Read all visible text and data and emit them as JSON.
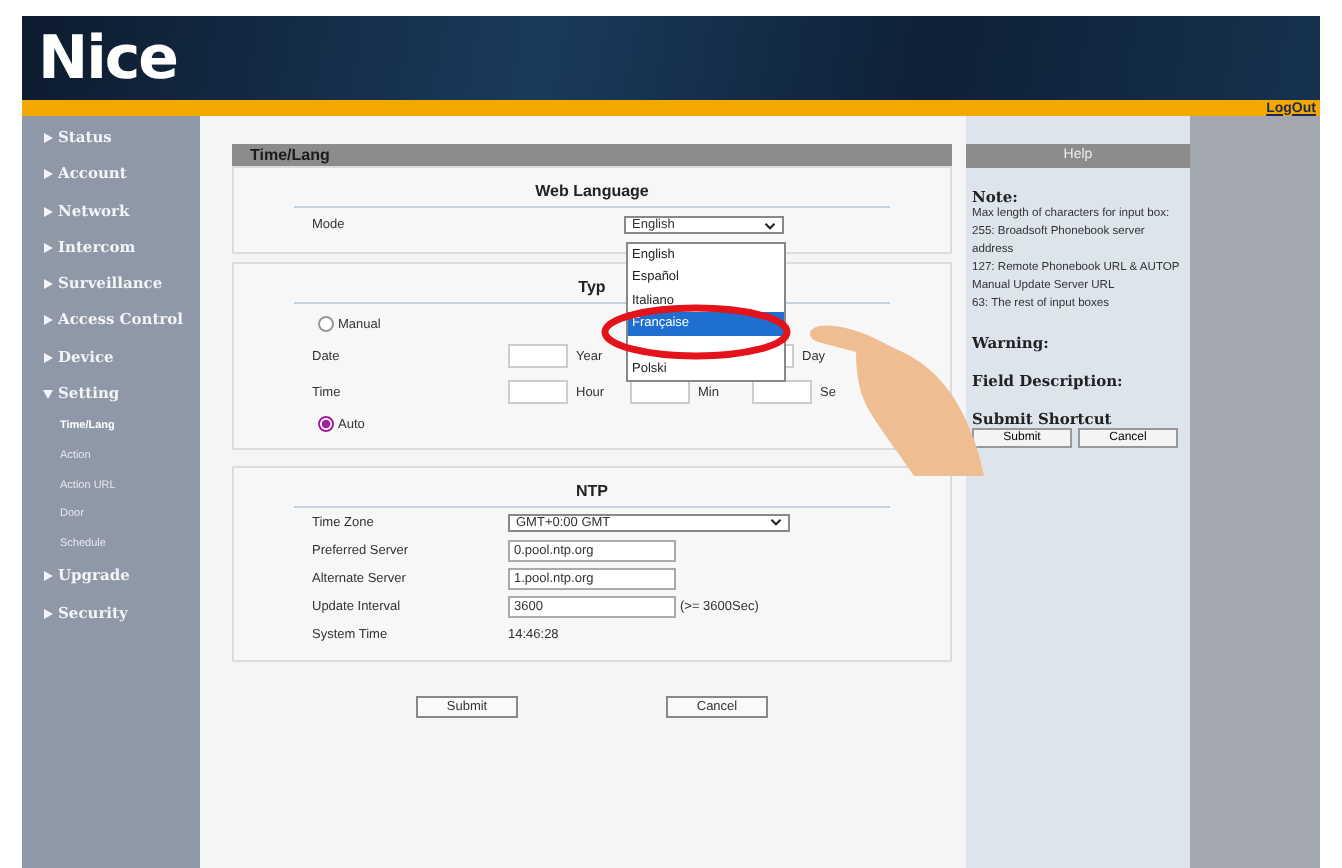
{
  "header": {
    "logo": "Nice",
    "logout": "LogOut"
  },
  "sidebar": {
    "items": [
      {
        "label": "Status",
        "expanded": false
      },
      {
        "label": "Account",
        "expanded": false
      },
      {
        "label": "Network",
        "expanded": false
      },
      {
        "label": "Intercom",
        "expanded": false
      },
      {
        "label": "Surveillance",
        "expanded": false
      },
      {
        "label": "Access Control",
        "expanded": false
      },
      {
        "label": "Device",
        "expanded": false
      },
      {
        "label": "Setting",
        "expanded": true,
        "children": [
          {
            "label": "Time/Lang",
            "selected": true
          },
          {
            "label": "Action",
            "selected": false
          },
          {
            "label": "Action URL",
            "selected": false
          },
          {
            "label": "Door",
            "selected": false
          },
          {
            "label": "Schedule",
            "selected": false
          }
        ]
      },
      {
        "label": "Upgrade",
        "expanded": false
      },
      {
        "label": "Security",
        "expanded": false
      }
    ]
  },
  "page_title": "Time/Lang",
  "web_language": {
    "title": "Web Language",
    "mode_label": "Mode",
    "mode_value": "English",
    "options": [
      {
        "label": "English",
        "selected": false
      },
      {
        "label": "Español",
        "selected": false
      },
      {
        "label": "Italiano",
        "selected": false
      },
      {
        "label": "Française",
        "selected": true
      },
      {
        "label": "Polski",
        "selected": false
      }
    ]
  },
  "type": {
    "title": "Typ",
    "manual": {
      "label": "Manual",
      "selected": false
    },
    "auto": {
      "label": "Auto",
      "selected": true
    },
    "date_label": "Date",
    "time_label": "Time",
    "date_units": [
      "Year",
      "Day"
    ],
    "time_units": [
      "Hour",
      "Min",
      "Se"
    ]
  },
  "ntp": {
    "title": "NTP",
    "rows": [
      {
        "kind": "select",
        "label": "Time Zone",
        "value": "GMT+0:00 GMT"
      },
      {
        "kind": "input",
        "label": "Preferred Server",
        "value": "0.pool.ntp.org"
      },
      {
        "kind": "input",
        "label": "Alternate Server",
        "value": "1.pool.ntp.org"
      },
      {
        "kind": "input",
        "label": "Update Interval",
        "value": "3600",
        "hint": "(>= 3600Sec)"
      },
      {
        "kind": "text",
        "label": "System Time",
        "value": "14:46:28"
      }
    ]
  },
  "buttons": [
    "Submit",
    "Cancel"
  ],
  "help": {
    "title": "Help",
    "note_title": "Note:",
    "note_lines": [
      "Max length of characters for input box:",
      "255: Broadsoft Phonebook server address",
      "127: Remote Phonebook URL & AUTOP Manual Update Server URL",
      "63: The rest of input boxes"
    ],
    "warning": "Warning:",
    "field_description": "Field Description:",
    "shortcut_title": "Submit Shortcut",
    "shortcut_buttons": [
      "Submit",
      "Cancel"
    ]
  }
}
